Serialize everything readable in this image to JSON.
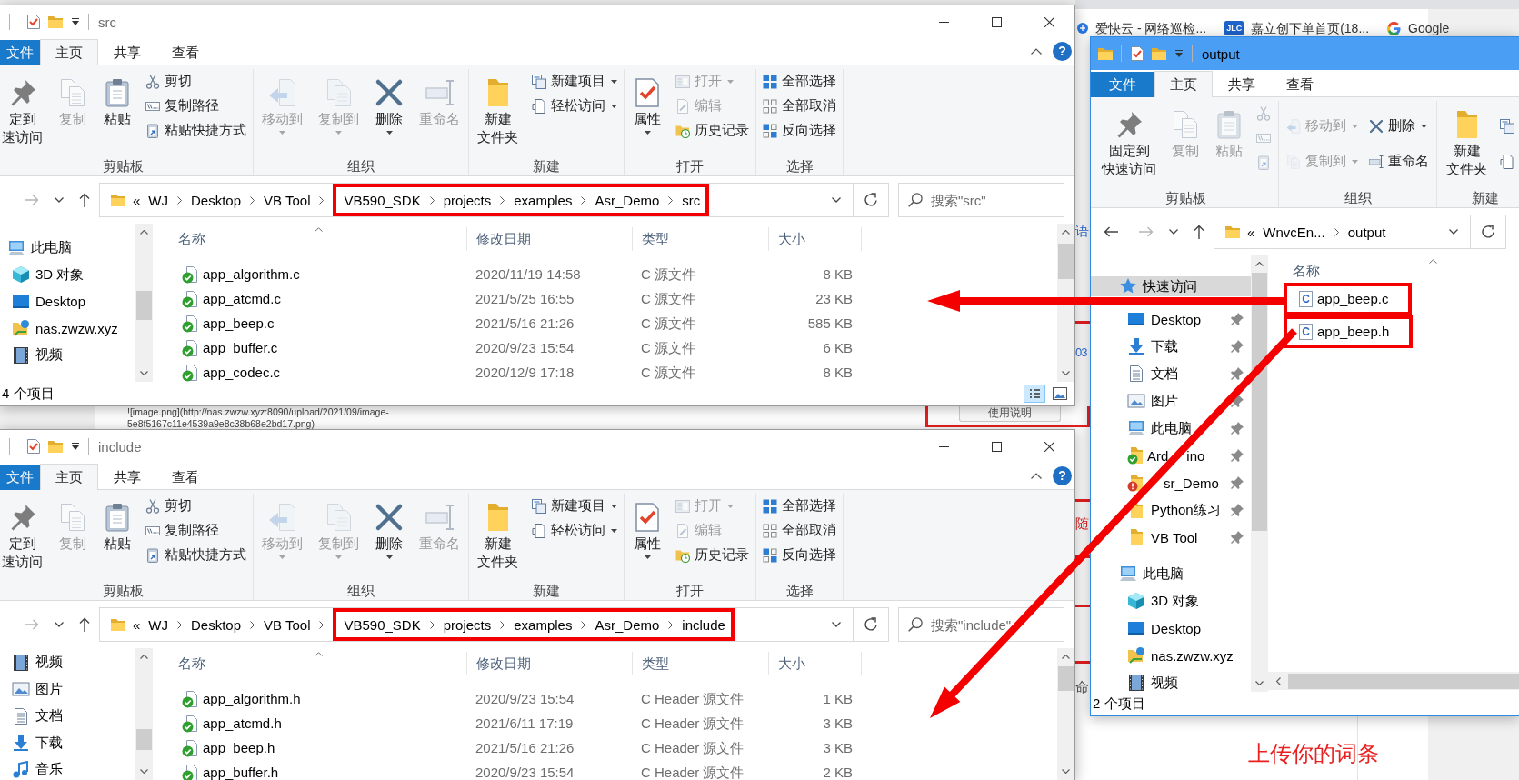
{
  "browser": {
    "bookmarks": [
      {
        "label": "爱快云 - 网络巡检...",
        "kind": "site"
      },
      {
        "label": "嘉立创下单首页(18...",
        "kind": "jlc",
        "logo_text": "JLC"
      },
      {
        "label": "Google",
        "kind": "google"
      }
    ],
    "fragments": [
      {
        "text": "语",
        "kind": "link"
      },
      {
        "text": "03",
        "kind": "link"
      },
      {
        "text": "随",
        "kind": "alert"
      },
      {
        "text": "命",
        "kind": "plain"
      }
    ],
    "markdown_lines": [
      "![image.png](http://nas.zwzw.xyz:8090/upload/2021/09/image-",
      "5e8f5167c11e4539a9e8c38b68e2bd17.png)"
    ],
    "manual_button": "使用说明",
    "upload_prompt": "上传你的词条"
  },
  "windows": [
    {
      "title": "src",
      "active": false,
      "frame_controls": true,
      "help": "?",
      "tabs": [
        {
          "label": "文件",
          "kind": "menu",
          "selected": false
        },
        {
          "label": "主页",
          "kind": "tab",
          "selected": true
        },
        {
          "label": "共享",
          "kind": "tab",
          "selected": false
        },
        {
          "label": "查看",
          "kind": "tab",
          "selected": false
        }
      ],
      "ribbon": [
        {
          "label": "剪贴板",
          "items": [
            {
              "kind": "pin",
              "lines": [
                "定到",
                "速访问"
              ],
              "disabled": false
            },
            {
              "kind": "copy",
              "label": "复制",
              "disabled": true
            },
            {
              "kind": "paste",
              "label": "粘贴",
              "disabled": false
            },
            {
              "stack": [
                {
                  "kind": "cut",
                  "label": "剪切",
                  "disabled": false
                },
                {
                  "kind": "copy-path",
                  "label": "复制路径",
                  "disabled": false
                },
                {
                  "kind": "paste-shortcut",
                  "label": "粘贴快捷方式",
                  "disabled": false
                }
              ]
            }
          ]
        },
        {
          "label": "组织",
          "items": [
            {
              "kind": "move-to",
              "label": "移动到",
              "disabled": true
            },
            {
              "kind": "copy-to",
              "label": "复制到",
              "disabled": true
            },
            {
              "kind": "delete",
              "label": "删除",
              "disabled": false
            },
            {
              "kind": "rename",
              "label": "重命名",
              "disabled": true
            }
          ]
        },
        {
          "label": "新建",
          "items": [
            {
              "kind": "new-folder",
              "lines": [
                "新建",
                "文件夹"
              ],
              "disabled": false
            },
            {
              "stack": [
                {
                  "kind": "new-item",
                  "label": "新建项目",
                  "disabled": false
                },
                {
                  "kind": "easy-access",
                  "label": "轻松访问",
                  "disabled": false
                }
              ]
            }
          ]
        },
        {
          "label": "打开",
          "items": [
            {
              "kind": "properties",
              "label": "属性",
              "disabled": false
            },
            {
              "stack": [
                {
                  "kind": "open",
                  "label": "打开",
                  "disabled": true
                },
                {
                  "kind": "edit",
                  "label": "编辑",
                  "disabled": true
                },
                {
                  "kind": "history",
                  "label": "历史记录",
                  "disabled": false
                }
              ]
            }
          ]
        },
        {
          "label": "选择",
          "items": [
            {
              "stack": [
                {
                  "kind": "select-all",
                  "label": "全部选择",
                  "disabled": false
                },
                {
                  "kind": "select-none",
                  "label": "全部取消",
                  "disabled": false
                },
                {
                  "kind": "invert-selection",
                  "label": "反向选择",
                  "disabled": false
                }
              ]
            }
          ]
        }
      ],
      "address": {
        "overflow": "«",
        "crumbs": [
          {
            "label": "WJ",
            "highlighted": false
          },
          {
            "label": "Desktop",
            "highlighted": false
          },
          {
            "label": "VB Tool",
            "highlighted": false
          },
          {
            "label": "VB590_SDK",
            "highlighted": true
          },
          {
            "label": "projects",
            "highlighted": true
          },
          {
            "label": "examples",
            "highlighted": true
          },
          {
            "label": "Asr_Demo",
            "highlighted": true
          },
          {
            "label": "src",
            "highlighted": true
          }
        ]
      },
      "search": {
        "placeholder": "搜索\"src\""
      },
      "nav": [
        {
          "label": "此电脑",
          "kind": "computer",
          "children": [
            {
              "label": "3D 对象",
              "kind": "objects"
            },
            {
              "label": "Desktop",
              "kind": "desktop"
            },
            {
              "label": "nas.zwzw.xyz",
              "kind": "network"
            },
            {
              "label": "视频",
              "kind": "videos"
            }
          ]
        }
      ],
      "columns": [
        "名称",
        "修改日期",
        "类型",
        "大小"
      ],
      "rows": [
        {
          "name": "app_algorithm.c",
          "date": "2020/11/19 14:58",
          "type": "C 源文件",
          "size": "8 KB",
          "synced": true
        },
        {
          "name": "app_atcmd.c",
          "date": "2021/5/25 16:55",
          "type": "C 源文件",
          "size": "23 KB",
          "synced": true
        },
        {
          "name": "app_beep.c",
          "date": "2021/5/16 21:26",
          "type": "C 源文件",
          "size": "585 KB",
          "synced": true
        },
        {
          "name": "app_buffer.c",
          "date": "2020/9/23 15:54",
          "type": "C 源文件",
          "size": "6 KB",
          "synced": true
        },
        {
          "name": "app_codec.c",
          "date": "2020/12/9 17:18",
          "type": "C 源文件",
          "size": "8 KB",
          "synced": true
        }
      ],
      "status": "4 个项目",
      "views": [
        {
          "kind": "details",
          "selected": true
        },
        {
          "kind": "large-icons",
          "selected": false
        }
      ]
    },
    {
      "title": "include",
      "active": false,
      "frame_controls": true,
      "help": "?",
      "tabs": [
        {
          "label": "文件",
          "kind": "menu",
          "selected": false
        },
        {
          "label": "主页",
          "kind": "tab",
          "selected": true
        },
        {
          "label": "共享",
          "kind": "tab",
          "selected": false
        },
        {
          "label": "查看",
          "kind": "tab",
          "selected": false
        }
      ],
      "ribbon": [
        {
          "label": "剪贴板",
          "items": [
            {
              "kind": "pin",
              "lines": [
                "定到",
                "速访问"
              ],
              "disabled": false
            },
            {
              "kind": "copy",
              "label": "复制",
              "disabled": true
            },
            {
              "kind": "paste",
              "label": "粘贴",
              "disabled": false
            },
            {
              "stack": [
                {
                  "kind": "cut",
                  "label": "剪切",
                  "disabled": false
                },
                {
                  "kind": "copy-path",
                  "label": "复制路径",
                  "disabled": false
                },
                {
                  "kind": "paste-shortcut",
                  "label": "粘贴快捷方式",
                  "disabled": false
                }
              ]
            }
          ]
        },
        {
          "label": "组织",
          "items": [
            {
              "kind": "move-to",
              "label": "移动到",
              "disabled": true
            },
            {
              "kind": "copy-to",
              "label": "复制到",
              "disabled": true
            },
            {
              "kind": "delete",
              "label": "删除",
              "disabled": false
            },
            {
              "kind": "rename",
              "label": "重命名",
              "disabled": true
            }
          ]
        },
        {
          "label": "新建",
          "items": [
            {
              "kind": "new-folder",
              "lines": [
                "新建",
                "文件夹"
              ],
              "disabled": false
            },
            {
              "stack": [
                {
                  "kind": "new-item",
                  "label": "新建项目",
                  "disabled": false
                },
                {
                  "kind": "easy-access",
                  "label": "轻松访问",
                  "disabled": false
                }
              ]
            }
          ]
        },
        {
          "label": "打开",
          "items": [
            {
              "kind": "properties",
              "label": "属性",
              "disabled": false
            },
            {
              "stack": [
                {
                  "kind": "open",
                  "label": "打开",
                  "disabled": true
                },
                {
                  "kind": "edit",
                  "label": "编辑",
                  "disabled": true
                },
                {
                  "kind": "history",
                  "label": "历史记录",
                  "disabled": false
                }
              ]
            }
          ]
        },
        {
          "label": "选择",
          "items": [
            {
              "stack": [
                {
                  "kind": "select-all",
                  "label": "全部选择",
                  "disabled": false
                },
                {
                  "kind": "select-none",
                  "label": "全部取消",
                  "disabled": false
                },
                {
                  "kind": "invert-selection",
                  "label": "反向选择",
                  "disabled": false
                }
              ]
            }
          ]
        }
      ],
      "address": {
        "overflow": "«",
        "crumbs": [
          {
            "label": "WJ",
            "highlighted": false
          },
          {
            "label": "Desktop",
            "highlighted": false
          },
          {
            "label": "VB Tool",
            "highlighted": false
          },
          {
            "label": "VB590_SDK",
            "highlighted": true
          },
          {
            "label": "projects",
            "highlighted": true
          },
          {
            "label": "examples",
            "highlighted": true
          },
          {
            "label": "Asr_Demo",
            "highlighted": true
          },
          {
            "label": "include",
            "highlighted": true
          }
        ]
      },
      "search": {
        "placeholder": "搜索\"include\""
      },
      "nav": [
        {
          "label": "视频",
          "kind": "videos"
        },
        {
          "label": "图片",
          "kind": "pictures"
        },
        {
          "label": "文档",
          "kind": "documents"
        },
        {
          "label": "下载",
          "kind": "downloads"
        },
        {
          "label": "音乐",
          "kind": "music"
        }
      ],
      "columns": [
        "名称",
        "修改日期",
        "类型",
        "大小"
      ],
      "rows": [
        {
          "name": "app_algorithm.h",
          "date": "2020/9/23 15:54",
          "type": "C Header 源文件",
          "size": "1 KB",
          "synced": true
        },
        {
          "name": "app_atcmd.h",
          "date": "2021/6/11 17:19",
          "type": "C Header 源文件",
          "size": "3 KB",
          "synced": true
        },
        {
          "name": "app_beep.h",
          "date": "2021/5/16 21:26",
          "type": "C Header 源文件",
          "size": "3 KB",
          "synced": true
        },
        {
          "name": "app_buffer.h",
          "date": "2020/9/23 15:54",
          "type": "C Header 源文件",
          "size": "2 KB",
          "synced": true
        }
      ]
    },
    {
      "title": "output",
      "active": true,
      "frame_controls": false,
      "tabs": [
        {
          "label": "文件",
          "kind": "menu",
          "selected": false
        },
        {
          "label": "主页",
          "kind": "tab",
          "selected": true
        },
        {
          "label": "共享",
          "kind": "tab",
          "selected": false
        },
        {
          "label": "查看",
          "kind": "tab",
          "selected": false
        }
      ],
      "ribbon": [
        {
          "label": "剪贴板",
          "items": [
            {
              "kind": "pin",
              "lines": [
                "固定到",
                "快速访问"
              ],
              "disabled": false
            },
            {
              "kind": "copy",
              "label": "复制",
              "disabled": true
            },
            {
              "kind": "paste",
              "label": "粘贴",
              "disabled": true
            },
            {
              "stack": [
                {
                  "kind": "cut",
                  "disabled": true
                },
                {
                  "kind": "copy-path",
                  "disabled": true
                },
                {
                  "kind": "paste-shortcut",
                  "disabled": true
                }
              ]
            }
          ]
        },
        {
          "label": "组织",
          "items": [
            {
              "stack": [
                {
                  "kind": "move-to",
                  "label": "移动到",
                  "disabled": true
                },
                {
                  "kind": "copy-to",
                  "label": "复制到",
                  "disabled": true
                }
              ]
            },
            {
              "stack": [
                {
                  "kind": "delete",
                  "label": "删除",
                  "disabled": false
                },
                {
                  "kind": "rename",
                  "label": "重命名",
                  "disabled": false
                }
              ]
            }
          ]
        },
        {
          "label": "新建",
          "items": [
            {
              "kind": "new-folder",
              "lines": [
                "新建",
                "文件夹"
              ],
              "disabled": false
            },
            {
              "stack": [
                {
                  "kind": "new-item",
                  "disabled": false
                },
                {
                  "kind": "easy-access",
                  "disabled": false
                }
              ]
            }
          ]
        }
      ],
      "address": {
        "overflow": "«",
        "crumbs": [
          {
            "label": "WnvcEn..."
          },
          {
            "label": "output"
          }
        ]
      },
      "nav": [
        {
          "label": "快速访问",
          "kind": "quick-access",
          "selected": true,
          "pinned": false,
          "children": [
            {
              "label": "Desktop",
              "kind": "desktop",
              "selected": false,
              "pinned": true
            },
            {
              "label": "下载",
              "kind": "downloads",
              "selected": false,
              "pinned": true
            },
            {
              "label": "文档",
              "kind": "documents",
              "selected": false,
              "pinned": true
            },
            {
              "label": "图片",
              "kind": "pictures",
              "selected": false,
              "pinned": true
            },
            {
              "label": "此电脑",
              "kind": "computer",
              "selected": false,
              "pinned": true
            },
            {
              "label_parts": [
                "Ard",
                "ino"
              ],
              "kind": "synced-folder",
              "selected": false,
              "pinned": true
            },
            {
              "label": "sr_Demo",
              "kind": "error-folder",
              "selected": false,
              "pinned": true
            },
            {
              "label": "Python练习",
              "kind": "folder",
              "selected": false,
              "pinned": true
            },
            {
              "label": "VB Tool",
              "kind": "folder",
              "selected": false,
              "pinned": true
            }
          ]
        },
        {
          "label": "此电脑",
          "kind": "computer",
          "selected": false,
          "pinned": false,
          "children": [
            {
              "label": "3D 对象",
              "kind": "objects",
              "selected": false,
              "pinned": false
            },
            {
              "label": "Desktop",
              "kind": "desktop",
              "selected": false,
              "pinned": false
            },
            {
              "label": "nas.zwzw.xyz",
              "kind": "network",
              "selected": false,
              "pinned": false
            },
            {
              "label": "视频",
              "kind": "videos",
              "selected": false,
              "pinned": false
            }
          ]
        }
      ],
      "columns": [
        "名称"
      ],
      "rows": [
        {
          "name": "app_beep.c",
          "icon_text": "C",
          "highlighted": true
        },
        {
          "name": "app_beep.h",
          "icon_text": "C",
          "highlighted": true
        }
      ],
      "status": "2 个项目"
    }
  ]
}
